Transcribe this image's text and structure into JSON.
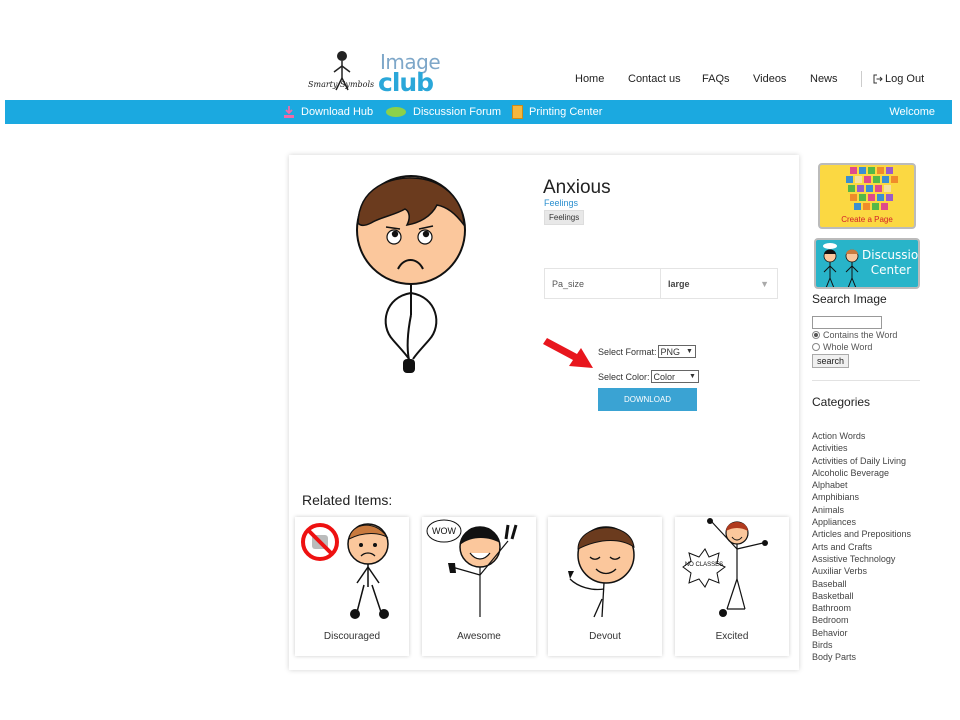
{
  "header": {
    "logo": {
      "line1": "Image",
      "line2": "club",
      "script": "Smarty Symbols"
    },
    "nav": {
      "home": "Home",
      "contact": "Contact us",
      "faqs": "FAQs",
      "videos": "Videos",
      "news": "News",
      "logout": "Log Out"
    }
  },
  "toolbar": {
    "download_hub": "Download Hub",
    "discussion_forum": "Discussion Forum",
    "printing_center": "Printing Center",
    "welcome": "Welcome"
  },
  "product": {
    "title": "Anxious",
    "category_link": "Feelings",
    "tag": "Feelings",
    "size_label": "Pa_size",
    "size_value": "large",
    "format_label": "Select Format:",
    "format_value": "PNG",
    "color_label": "Select Color:",
    "color_value": "Color",
    "download_label": "DOWNLOAD"
  },
  "related": {
    "title": "Related Items:",
    "items": [
      {
        "label": "Discouraged"
      },
      {
        "label": "Awesome",
        "bubble": "WOW"
      },
      {
        "label": "Devout"
      },
      {
        "label": "Excited",
        "bubble": "NO CLASSES"
      }
    ]
  },
  "sidebar": {
    "create_page": "Create a Page",
    "discussion_center_1": "Discussion",
    "discussion_center_2": "Center",
    "search_title": "Search Image",
    "search_value": "",
    "contains_word": "Contains the Word",
    "whole_word": "Whole Word",
    "search_button": "search",
    "categories_title": "Categories",
    "categories": [
      "Action Words",
      "Activities",
      "Activities of Daily Living",
      "Alcoholic Beverage",
      "Alphabet",
      "Amphibians",
      "Animals",
      "Appliances",
      "Articles and Prepositions",
      "Arts and Crafts",
      "Assistive Technology",
      "Auxiliar Verbs",
      "Baseball",
      "Basketball",
      "Bathroom",
      "Bedroom",
      "Behavior",
      "Birds",
      "Body Parts"
    ]
  },
  "colors": {
    "brand_blue": "#1ba9e0",
    "download_button": "#3aa3d3",
    "link": "#2a8fcf",
    "arrow": "#e8161d",
    "create_page_bg": "#fbd842",
    "discussion_bg": "#28b4c9"
  }
}
